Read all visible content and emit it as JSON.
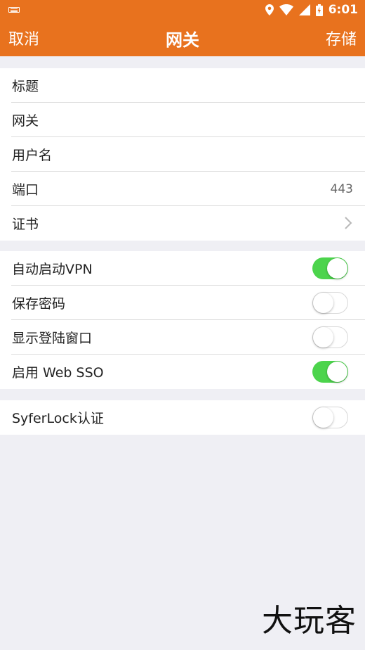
{
  "status_bar": {
    "time": "6:01"
  },
  "nav": {
    "cancel": "取消",
    "title": "网关",
    "save": "存储"
  },
  "group1": [
    {
      "label": "标题",
      "value": ""
    },
    {
      "label": "网关",
      "value": ""
    },
    {
      "label": "用户名",
      "value": ""
    },
    {
      "label": "端口",
      "value": "443"
    },
    {
      "label": "证书",
      "value": ""
    }
  ],
  "group2": [
    {
      "label": "自动启动VPN",
      "on": true
    },
    {
      "label": "保存密码",
      "on": false
    },
    {
      "label": "显示登陆窗口",
      "on": false
    },
    {
      "label": "启用 Web SSO",
      "on": true
    }
  ],
  "group3": [
    {
      "label": "SyferLock认证",
      "on": false
    }
  ],
  "watermark": "大玩客",
  "colors": {
    "accent": "#e8721e",
    "toggle_on": "#4cd44c",
    "background": "#efeff4"
  }
}
